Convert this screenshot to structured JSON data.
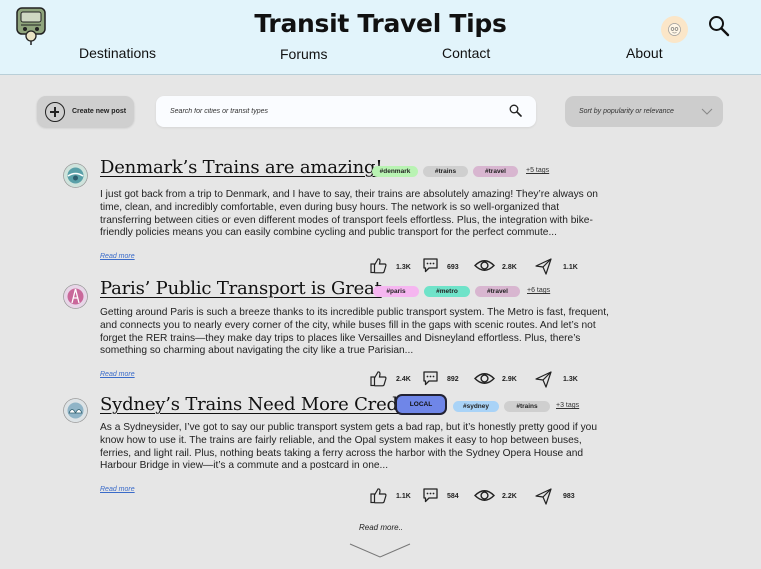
{
  "header": {
    "title": "Transit Travel Tips",
    "nav": [
      "Destinations",
      "Forums",
      "Contact",
      "About"
    ]
  },
  "toolbar": {
    "create_label": "Create new post",
    "search_placeholder": "Search for cities or transit types",
    "sort_label": "Sort by popularity or relevance"
  },
  "posts": [
    {
      "title": "Denmark’s Trains are amazing!",
      "tags": [
        "#denmark",
        "#trains",
        "#travel"
      ],
      "more_tags": "+5 tags",
      "body": "I just got back from a trip to Denmark, and I have to say, their trains are absolutely amazing! They’re always on time, clean, and incredibly comfortable, even during busy hours. The network is so well-organized that transferring between cities or even different modes of transport feels effortless. Plus, the integration with bike-friendly policies means you can easily combine cycling and public transport for the perfect commute...",
      "read_more": "Read more",
      "stats": {
        "likes": "1.3K",
        "comments": "693",
        "views": "2.8K",
        "shares": "1.1K"
      }
    },
    {
      "title": "Paris’ Public Transport is Great",
      "tags": [
        "#paris",
        "#metro",
        "#travel"
      ],
      "more_tags": "+6 tags",
      "body": "Getting around Paris is such a breeze thanks to its incredible public transport system. The Metro is fast, frequent, and connects you to nearly every corner of the city, while buses fill in the gaps with scenic routes. And let’s not forget the RER trains—they make day trips to places like Versailles and Disneyland effortless. Plus, there’s something so charming about navigating the city like a true Parisian...",
      "read_more": "Read more",
      "stats": {
        "likes": "2.4K",
        "comments": "892",
        "views": "2.9K",
        "shares": "1.3K"
      }
    },
    {
      "title": "Sydney’s Trains Need More Credit",
      "badge": "LOCAL",
      "tags": [
        "#sydney",
        "#trains"
      ],
      "more_tags": "+3 tags",
      "body": "As a Sydneysider, I’ve got to say our public transport system gets a bad rap, but it’s honestly pretty good if you know how to use it. The trains are fairly reliable, and the Opal system makes it easy to hop between buses, ferries, and light rail. Plus, nothing beats taking a ferry across the harbor with the Sydney Opera House and Harbour Bridge in view—it’s a commute and a postcard in one...",
      "read_more": "Read more",
      "stats": {
        "likes": "1.1K",
        "comments": "584",
        "views": "2.2K",
        "shares": "983"
      }
    }
  ],
  "footer": {
    "read_more": "Read more.."
  },
  "colors": {
    "header_bg": "#e2f4fb",
    "page_bg": "#e6e6e6",
    "tag_green": "#b9f3b3",
    "tag_gray": "#cfcfcf",
    "tag_purple": "#d8b6d0",
    "tag_pink": "#f5b6f0",
    "tag_teal": "#6fe3c9",
    "tag_blue": "#a9d3f7",
    "badge_local": "#6f86e8",
    "link": "#3a6bc9"
  }
}
